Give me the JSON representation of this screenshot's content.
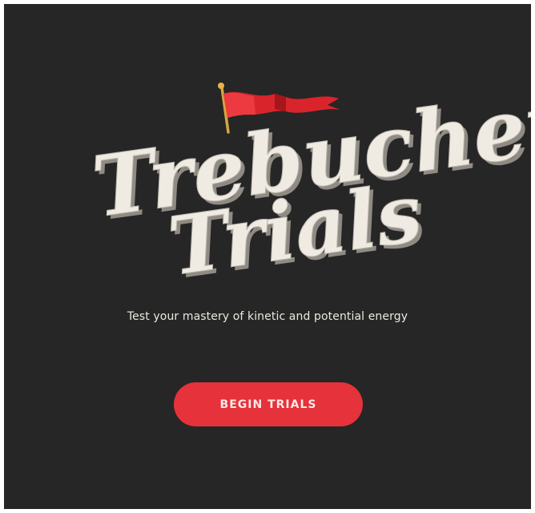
{
  "title": {
    "line1": "Trebuchet",
    "line2": "Trials"
  },
  "tagline": "Test your mastery of kinetic and potential energy",
  "begin_button": {
    "label": "BEGIN TRIALS"
  },
  "colors": {
    "background": "#262626",
    "title": "#efebe3",
    "flag": "#d9242c",
    "flag_pole": "#e0a93a",
    "button": "#e5323b",
    "button_text": "#fde7e7"
  },
  "icons": {
    "flag": "pennant-flag-icon"
  }
}
